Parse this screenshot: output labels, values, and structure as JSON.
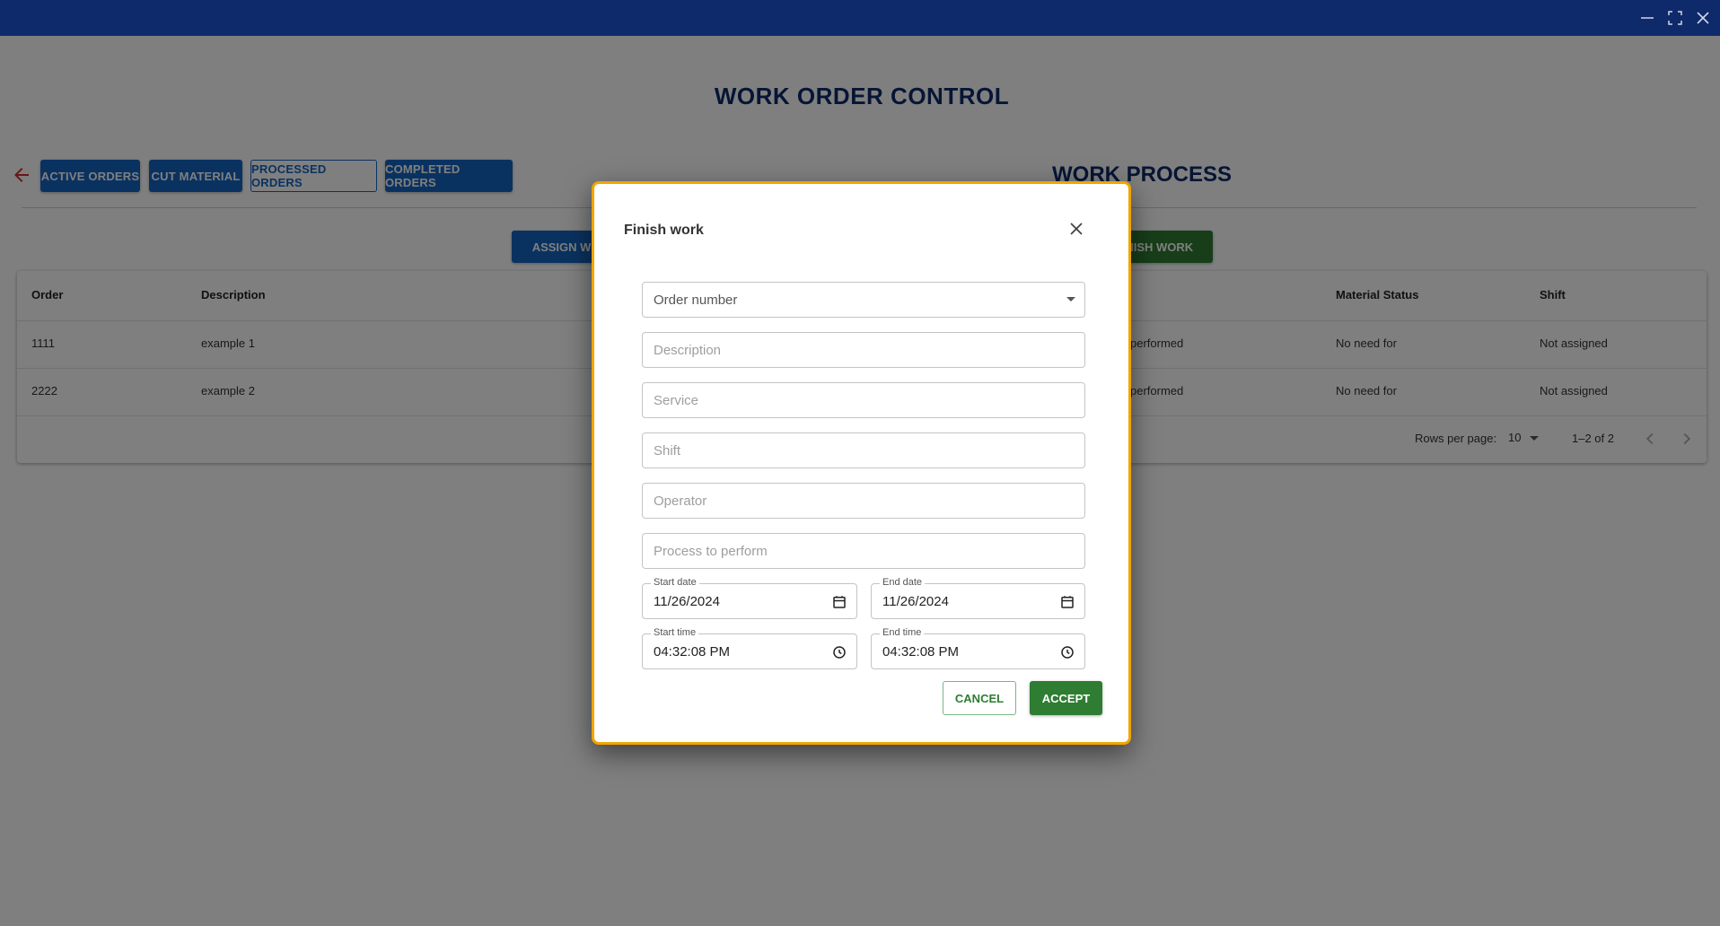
{
  "window": {
    "minimize_icon": "minimize-icon",
    "maximize_icon": "maximize-icon",
    "close_icon": "close-icon"
  },
  "page": {
    "title": "WORK ORDER CONTROL",
    "section_title": "WORK PROCESS"
  },
  "tabs": [
    {
      "label": "ACTIVE ORDERS",
      "style": "solid"
    },
    {
      "label": "CUT MATERIAL",
      "style": "solid"
    },
    {
      "label": "PROCESSED ORDERS",
      "style": "outline"
    },
    {
      "label": "COMPLETED ORDERS",
      "style": "solid"
    }
  ],
  "actions": {
    "assign_label": "ASSIGN WORK",
    "finish_label": "FINISH WORK"
  },
  "table": {
    "columns": [
      "Order",
      "Description",
      "Material Status",
      "Shift"
    ],
    "rows": [
      {
        "order": "1111",
        "description": "example 1",
        "status": "performed",
        "material_status": "No need for",
        "shift": "Not assigned"
      },
      {
        "order": "2222",
        "description": "example 2",
        "status": "performed",
        "material_status": "No need for",
        "shift": "Not assigned"
      }
    ],
    "pagination": {
      "rows_per_page_label": "Rows per page:",
      "rows_per_page": "10",
      "range": "1–2 of 2"
    }
  },
  "dialog": {
    "title": "Finish work",
    "order_number_placeholder": "Order number",
    "description_placeholder": "Description",
    "service_placeholder": "Service",
    "shift_placeholder": "Shift",
    "operator_placeholder": "Operator",
    "process_placeholder": "Process to perform",
    "start_date_label": "Start date",
    "start_date_value": "11/26/2024",
    "end_date_label": "End date",
    "end_date_value": "11/26/2024",
    "start_time_label": "Start time",
    "start_time_value": "04:32:08 PM",
    "end_time_label": "End time",
    "end_time_value": "04:32:08 PM",
    "cancel_label": "CANCEL",
    "accept_label": "ACCEPT"
  },
  "colors": {
    "titlebar": "#0e2a6b",
    "primary": "#1565c0",
    "success": "#2e7d32",
    "dialog_border": "#f0a500",
    "back_arrow": "#d32f2f"
  }
}
